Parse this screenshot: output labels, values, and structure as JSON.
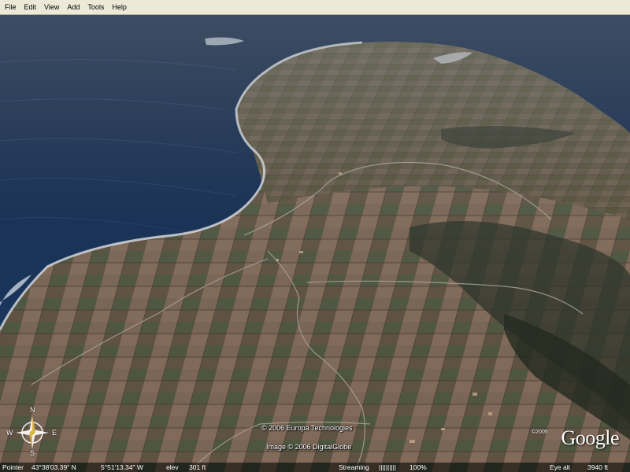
{
  "menu": {
    "items": [
      {
        "label": "File"
      },
      {
        "label": "Edit"
      },
      {
        "label": "View"
      },
      {
        "label": "Add"
      },
      {
        "label": "Tools"
      },
      {
        "label": "Help"
      }
    ]
  },
  "compass": {
    "north": "N",
    "south": "S",
    "east": "E",
    "west": "W"
  },
  "credits": {
    "line1": "© 2006 Europa Technologies",
    "line2": "Image © 2006 DigitalGlobe"
  },
  "logo": {
    "year": "©2005",
    "text": "Google"
  },
  "status": {
    "pointer_label": "Pointer",
    "latitude": "43°38'03.39\" N",
    "longitude": "5°51'13.34\"  W",
    "elev_label": "elev",
    "elev_value": "301 ft",
    "streaming_label": "Streaming",
    "streaming_bar": "||||||||||",
    "streaming_percent": "100%",
    "eye_alt_label": "Eye  alt",
    "eye_alt_value": "3940 ft"
  },
  "colors": {
    "menubar": "#ece9d8",
    "ocean": "#13305b",
    "land": "#6b5a4a"
  }
}
